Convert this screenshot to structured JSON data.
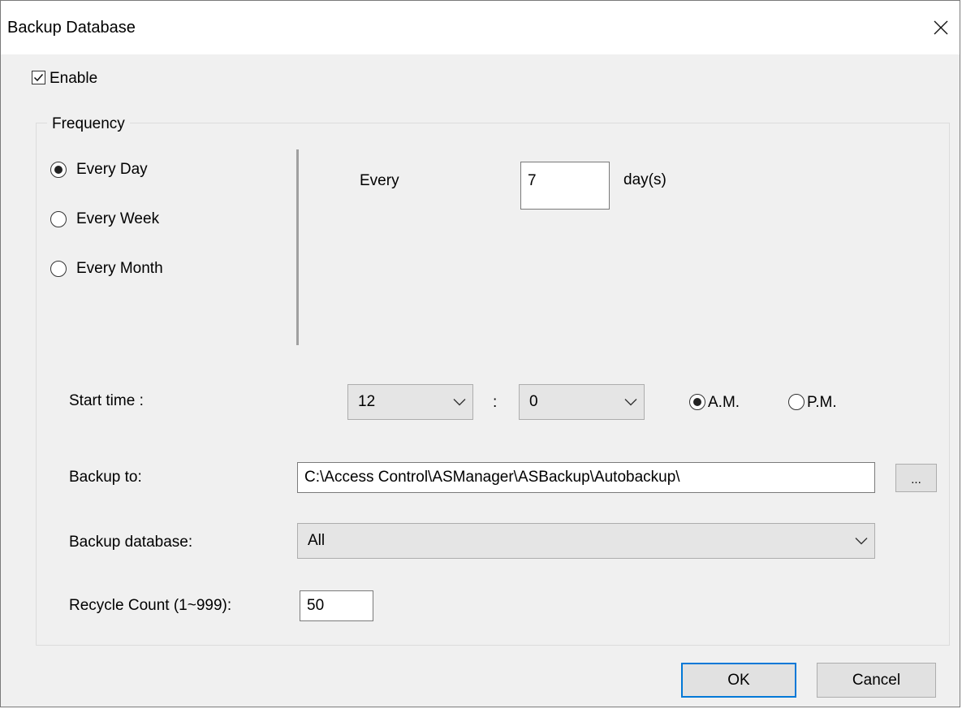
{
  "window": {
    "title": "Backup Database"
  },
  "enable": {
    "label": "Enable",
    "checked": true
  },
  "frequency": {
    "group_label": "Frequency",
    "options": [
      {
        "label": "Every Day",
        "selected": true
      },
      {
        "label": "Every Week",
        "selected": false
      },
      {
        "label": "Every Month",
        "selected": false
      }
    ],
    "every_label": "Every",
    "every_value": "7",
    "unit_label": "day(s)"
  },
  "start_time": {
    "label": "Start time :",
    "hour": "12",
    "separator": ":",
    "minute": "0",
    "am_label": "A.M.",
    "pm_label": "P.M.",
    "period": "A.M."
  },
  "backup_to": {
    "label": "Backup to:",
    "path": "C:\\Access Control\\ASManager\\ASBackup\\Autobackup\\",
    "browse_label": "..."
  },
  "backup_database": {
    "label": "Backup database:",
    "value": "All"
  },
  "recycle": {
    "label": "Recycle Count (1~999):",
    "value": "50"
  },
  "buttons": {
    "ok": "OK",
    "cancel": "Cancel"
  },
  "icons": {
    "close": "close-icon",
    "chevron": "chevron-down-icon",
    "check": "checkmark-icon"
  },
  "colors": {
    "accent": "#0078d7",
    "dialog_bg": "#f0f0f0"
  }
}
